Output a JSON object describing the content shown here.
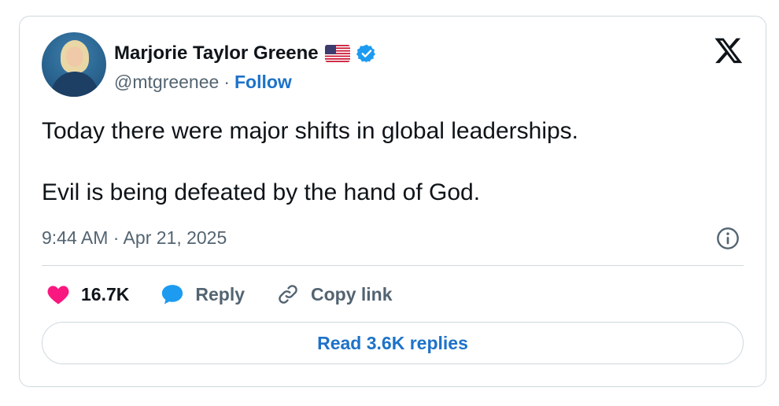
{
  "author": {
    "name": "Marjorie Taylor Greene",
    "handle": "@mtgreenee",
    "separator": "·",
    "follow_label": "Follow"
  },
  "tweet": {
    "lines": [
      "Today there were major shifts in global leaderships.",
      "Evil is being defeated by the hand of God."
    ],
    "timestamp": "9:44 AM · Apr 21, 2025"
  },
  "actions": {
    "likes": "16.7K",
    "reply_label": "Reply",
    "copy_link_label": "Copy link"
  },
  "read_replies_label": "Read 3.6K replies",
  "icons": [
    "avatar",
    "us-flag-icon",
    "verified-badge-icon",
    "x-logo-icon",
    "info-icon",
    "heart-icon",
    "reply-bubble-icon",
    "link-icon"
  ],
  "colors": {
    "accent": "#1d72c9",
    "verified": "#1d9bf0",
    "like": "#f91880",
    "muted_text": "#536471",
    "border": "#cfd9de"
  }
}
